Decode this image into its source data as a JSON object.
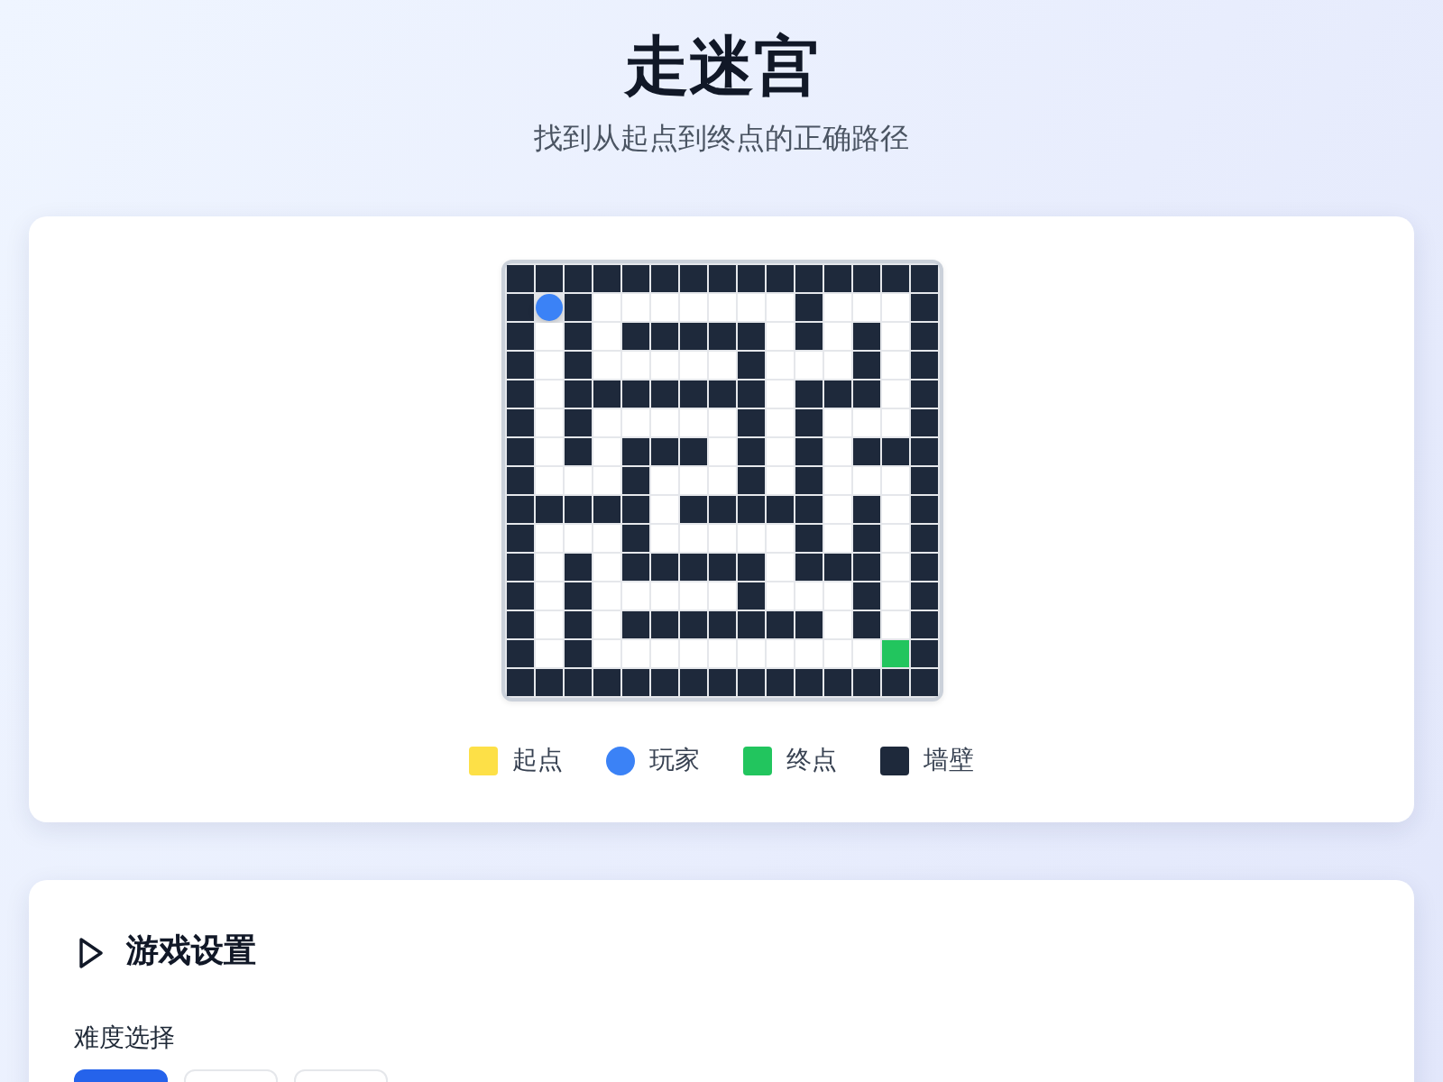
{
  "header": {
    "title": "走迷宫",
    "subtitle": "找到从起点到终点的正确路径"
  },
  "maze": {
    "rows": [
      [
        {
          "kind": "wall"
        },
        {
          "kind": "wall"
        },
        {
          "kind": "wall"
        },
        {
          "kind": "wall"
        },
        {
          "kind": "wall"
        },
        {
          "kind": "wall"
        },
        {
          "kind": "wall"
        },
        {
          "kind": "wall"
        },
        {
          "kind": "wall"
        },
        {
          "kind": "wall"
        },
        {
          "kind": "wall"
        },
        {
          "kind": "wall"
        },
        {
          "kind": "wall"
        },
        {
          "kind": "wall"
        },
        {
          "kind": "wall"
        }
      ],
      [
        {
          "kind": "wall"
        },
        {
          "kind": "player"
        },
        {
          "kind": "wall"
        },
        {
          "kind": "floor"
        },
        {
          "kind": "floor"
        },
        {
          "kind": "floor"
        },
        {
          "kind": "floor"
        },
        {
          "kind": "floor"
        },
        {
          "kind": "floor"
        },
        {
          "kind": "floor"
        },
        {
          "kind": "wall"
        },
        {
          "kind": "floor"
        },
        {
          "kind": "floor"
        },
        {
          "kind": "floor"
        },
        {
          "kind": "wall"
        }
      ],
      [
        {
          "kind": "wall"
        },
        {
          "kind": "floor"
        },
        {
          "kind": "wall"
        },
        {
          "kind": "floor"
        },
        {
          "kind": "wall"
        },
        {
          "kind": "wall"
        },
        {
          "kind": "wall"
        },
        {
          "kind": "wall"
        },
        {
          "kind": "wall"
        },
        {
          "kind": "floor"
        },
        {
          "kind": "wall"
        },
        {
          "kind": "floor"
        },
        {
          "kind": "wall"
        },
        {
          "kind": "floor"
        },
        {
          "kind": "wall"
        }
      ],
      [
        {
          "kind": "wall"
        },
        {
          "kind": "floor"
        },
        {
          "kind": "wall"
        },
        {
          "kind": "floor"
        },
        {
          "kind": "floor"
        },
        {
          "kind": "floor"
        },
        {
          "kind": "floor"
        },
        {
          "kind": "floor"
        },
        {
          "kind": "wall"
        },
        {
          "kind": "floor"
        },
        {
          "kind": "floor"
        },
        {
          "kind": "floor"
        },
        {
          "kind": "wall"
        },
        {
          "kind": "floor"
        },
        {
          "kind": "wall"
        }
      ],
      [
        {
          "kind": "wall"
        },
        {
          "kind": "floor"
        },
        {
          "kind": "wall"
        },
        {
          "kind": "wall"
        },
        {
          "kind": "wall"
        },
        {
          "kind": "wall"
        },
        {
          "kind": "wall"
        },
        {
          "kind": "wall"
        },
        {
          "kind": "wall"
        },
        {
          "kind": "floor"
        },
        {
          "kind": "wall"
        },
        {
          "kind": "wall"
        },
        {
          "kind": "wall"
        },
        {
          "kind": "floor"
        },
        {
          "kind": "wall"
        }
      ],
      [
        {
          "kind": "wall"
        },
        {
          "kind": "floor"
        },
        {
          "kind": "wall"
        },
        {
          "kind": "floor"
        },
        {
          "kind": "floor"
        },
        {
          "kind": "floor"
        },
        {
          "kind": "floor"
        },
        {
          "kind": "floor"
        },
        {
          "kind": "wall"
        },
        {
          "kind": "floor"
        },
        {
          "kind": "wall"
        },
        {
          "kind": "floor"
        },
        {
          "kind": "floor"
        },
        {
          "kind": "floor"
        },
        {
          "kind": "wall"
        }
      ],
      [
        {
          "kind": "wall"
        },
        {
          "kind": "floor"
        },
        {
          "kind": "wall"
        },
        {
          "kind": "floor"
        },
        {
          "kind": "wall"
        },
        {
          "kind": "wall"
        },
        {
          "kind": "wall"
        },
        {
          "kind": "floor"
        },
        {
          "kind": "wall"
        },
        {
          "kind": "floor"
        },
        {
          "kind": "wall"
        },
        {
          "kind": "floor"
        },
        {
          "kind": "wall"
        },
        {
          "kind": "wall"
        },
        {
          "kind": "wall"
        }
      ],
      [
        {
          "kind": "wall"
        },
        {
          "kind": "floor"
        },
        {
          "kind": "floor"
        },
        {
          "kind": "floor"
        },
        {
          "kind": "wall"
        },
        {
          "kind": "floor"
        },
        {
          "kind": "floor"
        },
        {
          "kind": "floor"
        },
        {
          "kind": "wall"
        },
        {
          "kind": "floor"
        },
        {
          "kind": "wall"
        },
        {
          "kind": "floor"
        },
        {
          "kind": "floor"
        },
        {
          "kind": "floor"
        },
        {
          "kind": "wall"
        }
      ],
      [
        {
          "kind": "wall"
        },
        {
          "kind": "wall"
        },
        {
          "kind": "wall"
        },
        {
          "kind": "wall"
        },
        {
          "kind": "wall"
        },
        {
          "kind": "floor"
        },
        {
          "kind": "wall"
        },
        {
          "kind": "wall"
        },
        {
          "kind": "wall"
        },
        {
          "kind": "wall"
        },
        {
          "kind": "wall"
        },
        {
          "kind": "floor"
        },
        {
          "kind": "wall"
        },
        {
          "kind": "floor"
        },
        {
          "kind": "wall"
        }
      ],
      [
        {
          "kind": "wall"
        },
        {
          "kind": "floor"
        },
        {
          "kind": "floor"
        },
        {
          "kind": "floor"
        },
        {
          "kind": "wall"
        },
        {
          "kind": "floor"
        },
        {
          "kind": "floor"
        },
        {
          "kind": "floor"
        },
        {
          "kind": "floor"
        },
        {
          "kind": "floor"
        },
        {
          "kind": "wall"
        },
        {
          "kind": "floor"
        },
        {
          "kind": "wall"
        },
        {
          "kind": "floor"
        },
        {
          "kind": "wall"
        }
      ],
      [
        {
          "kind": "wall"
        },
        {
          "kind": "floor"
        },
        {
          "kind": "wall"
        },
        {
          "kind": "floor"
        },
        {
          "kind": "wall"
        },
        {
          "kind": "wall"
        },
        {
          "kind": "wall"
        },
        {
          "kind": "wall"
        },
        {
          "kind": "wall"
        },
        {
          "kind": "floor"
        },
        {
          "kind": "wall"
        },
        {
          "kind": "wall"
        },
        {
          "kind": "wall"
        },
        {
          "kind": "floor"
        },
        {
          "kind": "wall"
        }
      ],
      [
        {
          "kind": "wall"
        },
        {
          "kind": "floor"
        },
        {
          "kind": "wall"
        },
        {
          "kind": "floor"
        },
        {
          "kind": "floor"
        },
        {
          "kind": "floor"
        },
        {
          "kind": "floor"
        },
        {
          "kind": "floor"
        },
        {
          "kind": "wall"
        },
        {
          "kind": "floor"
        },
        {
          "kind": "floor"
        },
        {
          "kind": "floor"
        },
        {
          "kind": "wall"
        },
        {
          "kind": "floor"
        },
        {
          "kind": "wall"
        }
      ],
      [
        {
          "kind": "wall"
        },
        {
          "kind": "floor"
        },
        {
          "kind": "wall"
        },
        {
          "kind": "floor"
        },
        {
          "kind": "wall"
        },
        {
          "kind": "wall"
        },
        {
          "kind": "wall"
        },
        {
          "kind": "wall"
        },
        {
          "kind": "wall"
        },
        {
          "kind": "wall"
        },
        {
          "kind": "wall"
        },
        {
          "kind": "floor"
        },
        {
          "kind": "wall"
        },
        {
          "kind": "floor"
        },
        {
          "kind": "wall"
        }
      ],
      [
        {
          "kind": "wall"
        },
        {
          "kind": "floor"
        },
        {
          "kind": "wall"
        },
        {
          "kind": "floor"
        },
        {
          "kind": "floor"
        },
        {
          "kind": "floor"
        },
        {
          "kind": "floor"
        },
        {
          "kind": "floor"
        },
        {
          "kind": "floor"
        },
        {
          "kind": "floor"
        },
        {
          "kind": "floor"
        },
        {
          "kind": "floor"
        },
        {
          "kind": "floor"
        },
        {
          "kind": "goal"
        },
        {
          "kind": "wall"
        }
      ],
      [
        {
          "kind": "wall"
        },
        {
          "kind": "wall"
        },
        {
          "kind": "wall"
        },
        {
          "kind": "wall"
        },
        {
          "kind": "wall"
        },
        {
          "kind": "wall"
        },
        {
          "kind": "wall"
        },
        {
          "kind": "wall"
        },
        {
          "kind": "wall"
        },
        {
          "kind": "wall"
        },
        {
          "kind": "wall"
        },
        {
          "kind": "wall"
        },
        {
          "kind": "wall"
        },
        {
          "kind": "wall"
        },
        {
          "kind": "wall"
        }
      ]
    ]
  },
  "legend": [
    {
      "label": "起点",
      "kind": "square",
      "color": "#fde047"
    },
    {
      "label": "玩家",
      "kind": "circle",
      "color": "#3b82f6"
    },
    {
      "label": "终点",
      "kind": "square",
      "color": "#22c55e"
    },
    {
      "label": "墙壁",
      "kind": "square",
      "color": "#1e293b"
    }
  ],
  "settings": {
    "title": "游戏设置",
    "difficulty": {
      "label": "难度选择",
      "options": [
        {
          "selected": true
        },
        {
          "selected": false
        },
        {
          "selected": false
        }
      ]
    }
  }
}
